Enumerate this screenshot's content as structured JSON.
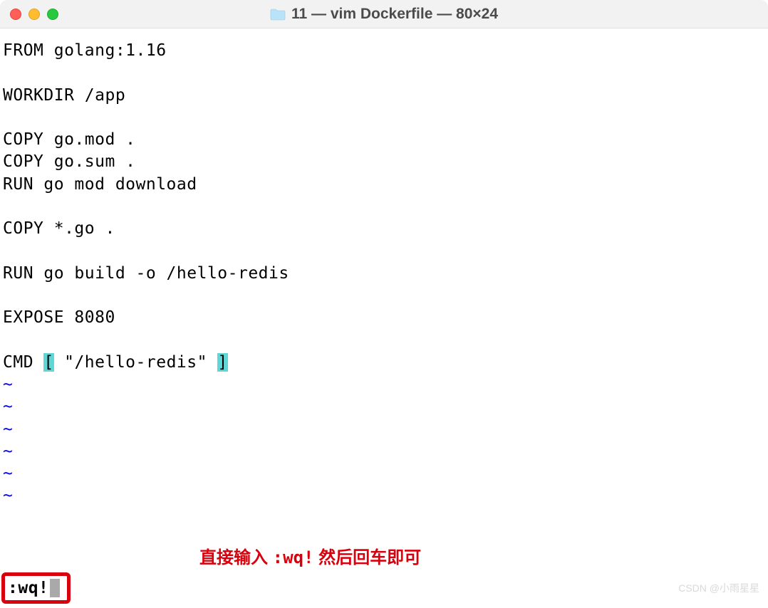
{
  "window": {
    "title": "11 — vim Dockerfile — 80×24"
  },
  "editor": {
    "lines": [
      "FROM golang:1.16",
      "",
      "WORKDIR /app",
      "",
      "COPY go.mod .",
      "COPY go.sum .",
      "RUN go mod download",
      "",
      "COPY *.go .",
      "",
      "RUN go build -o /hello-redis",
      "",
      "EXPOSE 8080",
      ""
    ],
    "cmd_line_prefix": "CMD ",
    "cmd_bracket_open": "[",
    "cmd_content": " \"/hello-redis\" ",
    "cmd_bracket_close": "]",
    "tilde": "~",
    "tilde_count": 6
  },
  "command": {
    "text": ":wq!"
  },
  "annotation": {
    "pre": "直接输入  ",
    "cmd": ":wq!",
    "post": "   然后回车即可"
  },
  "watermark": "CSDN @小雨星星"
}
